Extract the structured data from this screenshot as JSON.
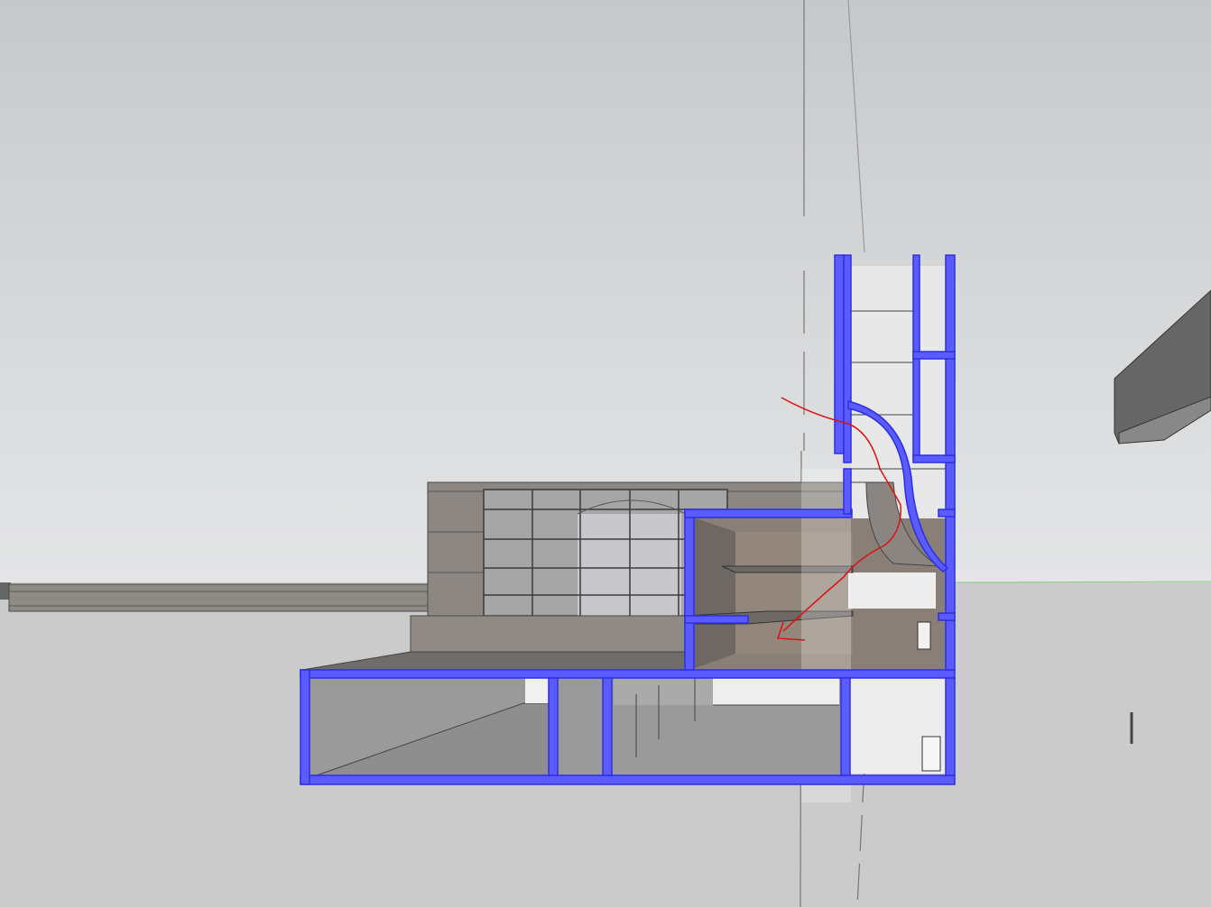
{
  "viewport": {
    "sky_top": "#c6c9cc",
    "sky_horizon": "#e4e5e6",
    "ground": "#cbcbcb",
    "horizon_axis": "#7fd07f"
  },
  "model": {
    "section_cut_color": "#5a5cff",
    "section_edge_color": "#2c2ee6",
    "wall_color": "#8c8782",
    "interior_color": "#9a9a9a",
    "annotation_color": "#e01010"
  }
}
